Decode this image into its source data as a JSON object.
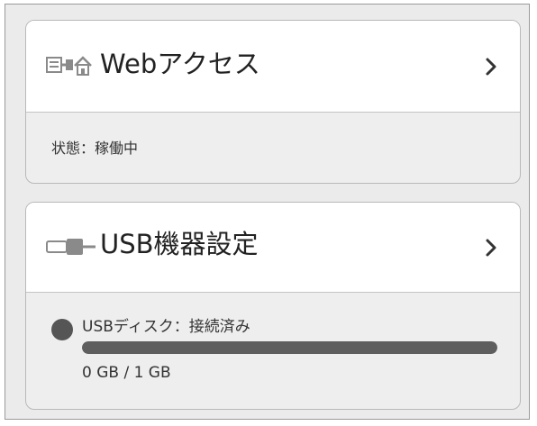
{
  "web_access": {
    "title": "Webアクセス",
    "icon": "network-house-icon",
    "status": "状態：稼働中"
  },
  "usb_settings": {
    "title": "USB機器設定",
    "icon": "usb-cable-icon",
    "disk_label": "USBディスク：接続済み",
    "capacity_text": "0 GB / 1 GB",
    "usage_bar_fill_fraction": 1.0
  },
  "colors": {
    "frame_bg": "#ebebeb",
    "card_header_bg": "#ffffff",
    "bar_fill": "#5e5e5e",
    "status_dot": "#555555"
  }
}
